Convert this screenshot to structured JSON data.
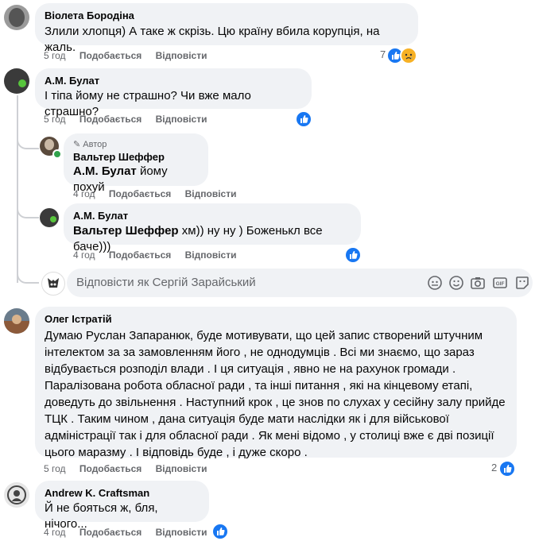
{
  "comments": [
    {
      "author": "Віолета Бородіна",
      "text": "Злили хлопця) А таке ж скрізь. Цю країну вбила корупція, на жаль.",
      "time": "5 год",
      "like": "Подобається",
      "reply": "Відповісти",
      "reactions": "7"
    },
    {
      "author": "А.М. Булат",
      "text": "І тіпа йому не страшно? Чи вже мало страшно?",
      "time": "5 год",
      "like": "Подобається",
      "reply": "Відповісти"
    }
  ],
  "replies": [
    {
      "badge": "Автор",
      "author": "Вальтер Шеффер",
      "mention": "А.М. Булат",
      "text": " йому похуй",
      "time": "4 год",
      "like": "Подобається",
      "reply": "Відповісти"
    },
    {
      "author": "А.М. Булат",
      "mention": "Вальтер Шеффер",
      "text": " хм)) ну ну ) Боженькл все баче)))",
      "time": "4 год",
      "like": "Подобається",
      "reply": "Відповісти"
    }
  ],
  "reply_box": {
    "placeholder": "Відповісти як Сергій Зарайський"
  },
  "comment3": {
    "author": "Олег Істратій",
    "lines": [
      "Думаю Руслан Запаранюк, буде мотивувати, що цей запис створений штучним",
      "інтелектом за за замовленням його , не однодумців . Всі ми знаємо, що зараз",
      "відбувається розподіл влади . І ця ситуація , явно не на рахунок громади .",
      "Паралізована робота обласної ради , та інші питання , які на кінцевому етапі,",
      "доведуть до звільнення . Наступний крок , це знов по слухах у сесійну залу прийде",
      "ТЦК . Таким чином , дана ситуація буде мати наслідки як і для військової",
      "адміністрації так і для обласної ради . Як мені відомо , у столиці вже є дві позиції",
      "цього маразму . І відповідь буде , і дуже скоро ."
    ],
    "time": "5 год",
    "like": "Подобається",
    "reply": "Відповісти",
    "reactions": "2"
  },
  "comment4": {
    "author": "Andrew K. Craftsman",
    "text": "Й не бояться ж, бля, нічого...",
    "time": "4 год",
    "like": "Подобається",
    "reply": "Відповісти"
  },
  "colors": {
    "bubble": "#f0f2f5",
    "meta": "#65676b",
    "like_blue": "#1877f2"
  },
  "icons": [
    "like-icon",
    "sad-icon",
    "pencil-icon",
    "emoji-icon",
    "camera-icon",
    "gif-icon",
    "sticker-icon",
    "avatar-sticker-icon"
  ]
}
